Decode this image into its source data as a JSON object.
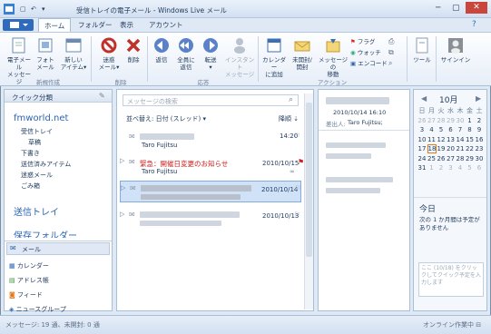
{
  "window": {
    "title": "受信トレイの電子メール - Windows Live メール"
  },
  "tabs": [
    "ホーム",
    "フォルダー",
    "表示",
    "アカウント"
  ],
  "ribbon": {
    "buttons": [
      {
        "label1": "電子メール",
        "label2": "メッセージ",
        "icon": "new-email-icon"
      },
      {
        "label1": "フォト",
        "label2": "メール",
        "icon": "photo-mail-icon"
      },
      {
        "label1": "新しい",
        "label2": "アイテム▾",
        "icon": "new-items-icon"
      },
      {
        "label1": "迷惑",
        "label2": "メール▾",
        "icon": "junk-icon"
      },
      {
        "label1": "削除",
        "label2": "",
        "icon": "delete-icon"
      },
      {
        "label1": "返信",
        "label2": "",
        "icon": "reply-icon"
      },
      {
        "label1": "全員に",
        "label2": "返信",
        "icon": "reply-all-icon"
      },
      {
        "label1": "転送",
        "label2": "▾",
        "icon": "forward-icon"
      },
      {
        "label1": "インスタント",
        "label2": "メッセージ",
        "icon": "instant-message-icon"
      },
      {
        "label1": "カレンダー",
        "label2": "に追加",
        "icon": "calendar-add-icon"
      },
      {
        "label1": "未開封/",
        "label2": "開封",
        "icon": "unread-read-icon"
      },
      {
        "label1": "メッセージの",
        "label2": "移動",
        "icon": "move-icon"
      }
    ],
    "small": [
      {
        "label": "フラグ",
        "icon": "flag-icon"
      },
      {
        "label": "ウォッチ",
        "icon": "watch-icon"
      },
      {
        "label": "エンコード",
        "icon": "encode-icon"
      }
    ],
    "extra": {
      "label": "ツール",
      "icon": "tools-icon"
    },
    "signin": {
      "label": "サインイン",
      "icon": "signin-icon"
    },
    "groups": [
      "新規作成",
      "削除",
      "応答",
      "アクション"
    ]
  },
  "left": {
    "quick_views": "クイック分類",
    "account": "fmworld.net",
    "folders": [
      "受信トレイ",
      "草稿",
      "下書き",
      "送信済みアイテム",
      "迷惑メール",
      "ごみ箱"
    ],
    "outbox": "送信トレイ",
    "partial": "保存フォルダー",
    "nav": [
      {
        "label": "メール",
        "icon": "mail-icon"
      },
      {
        "label": "カレンダー",
        "icon": "calendar-icon"
      },
      {
        "label": "アドレス帳",
        "icon": "contacts-icon"
      },
      {
        "label": "フィード",
        "icon": "feed-icon"
      },
      {
        "label": "ニュースグループ",
        "icon": "newsgroup-icon"
      }
    ]
  },
  "list": {
    "search_placeholder": "メッセージの検索",
    "sort_label": "並べ替え: 日付 (スレッド) ▾",
    "sort_dir": "降順 ⇣",
    "messages": [
      {
        "sender": "Taro Fujitsu",
        "date": "14:20",
        "subject": "",
        "red": false,
        "selected": false
      },
      {
        "sender": "Taro Fujitsu",
        "date": "2010/10/15",
        "subject": "緊急：開催日変更のお知らせ",
        "red": true,
        "selected": false
      },
      {
        "sender": "",
        "date": "2010/10/14",
        "subject": "",
        "red": false,
        "selected": true
      },
      {
        "sender": "",
        "date": "2010/10/13",
        "subject": "",
        "red": false,
        "selected": false
      }
    ]
  },
  "reading": {
    "date": "2010/10/14 16:10",
    "from_label": "差出人:",
    "from": "Taro Fujitsu;"
  },
  "calendar": {
    "month": "10月",
    "weekdays": [
      "日",
      "月",
      "火",
      "水",
      "木",
      "金",
      "土"
    ],
    "days": [
      26,
      27,
      28,
      29,
      30,
      1,
      2,
      3,
      4,
      5,
      6,
      7,
      8,
      9,
      10,
      11,
      12,
      13,
      14,
      15,
      16,
      17,
      18,
      19,
      20,
      21,
      22,
      23,
      24,
      25,
      26,
      27,
      28,
      29,
      30,
      31,
      1,
      2,
      3,
      4,
      5,
      6
    ],
    "today_title": "今日",
    "today_text": "次の 1 か月間は予定がありません",
    "note": "ここ (10/18) をクリックしてクイック予定を入力します"
  },
  "status": {
    "left": "メッセージ: 19 通、未開封: 0 通",
    "right": "オンライン作業中 ⊟"
  }
}
